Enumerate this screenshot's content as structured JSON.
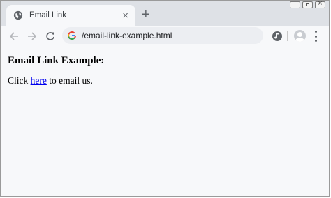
{
  "browser": {
    "tab": {
      "title": "Email Link",
      "close_symbol": "×",
      "favicon": "globe-icon"
    },
    "new_tab_symbol": "+",
    "address_bar": {
      "url": "/email-link-example.html",
      "site_icon": "google-g-icon"
    },
    "colors": {
      "frame": "#dee1e6",
      "toolbar": "#f7f8fa",
      "omnibox": "#eceef2",
      "icon": "#5f6368"
    }
  },
  "page": {
    "heading": "Email Link Example:",
    "text_before": "Click ",
    "link_text": "here",
    "text_after": " to email us.",
    "colors": {
      "link": "#0000ee"
    }
  }
}
